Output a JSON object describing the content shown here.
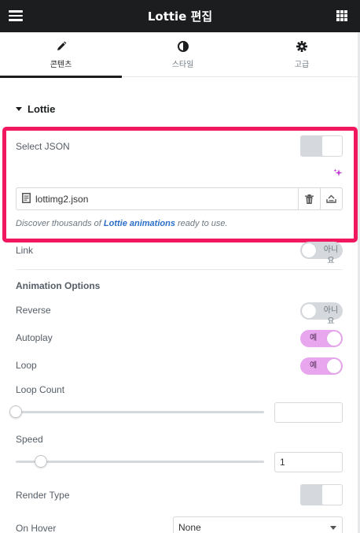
{
  "header": {
    "title": "Lottie 편집",
    "menu_icon": "hamburger-icon",
    "apps_icon": "grid-icon"
  },
  "tabs": [
    {
      "label": "콘텐츠",
      "icon": "pencil-icon",
      "active": true
    },
    {
      "label": "스타일",
      "icon": "half-circle-icon",
      "active": false
    },
    {
      "label": "고급",
      "icon": "gear-icon",
      "active": false
    }
  ],
  "section": {
    "title": "Lottie"
  },
  "select_json": {
    "label": "Select JSON",
    "ai_icon": "sparkle-icon",
    "accent": "#c036d4"
  },
  "file": {
    "name": "lottimg2.json",
    "delete_icon": "trash-icon",
    "upload_icon": "upload-icon"
  },
  "note": {
    "prefix": "Discover thousands of ",
    "link": "Lottie animations",
    "suffix": " ready to use."
  },
  "link_row": {
    "label": "Link",
    "switch_text": "아니요",
    "on": false
  },
  "animation_options": {
    "title": "Animation Options",
    "reverse": {
      "label": "Reverse",
      "switch_text": "아니요",
      "on": false
    },
    "autoplay": {
      "label": "Autoplay",
      "switch_text": "예",
      "on": true
    },
    "loop": {
      "label": "Loop",
      "switch_text": "예",
      "on": true
    },
    "loop_count": {
      "label": "Loop Count",
      "value": "",
      "slider_fraction": 0
    },
    "speed": {
      "label": "Speed",
      "value": "1",
      "slider_fraction": 0.1
    },
    "render_type": {
      "label": "Render Type"
    },
    "on_hover": {
      "label": "On Hover",
      "value": "None"
    }
  },
  "colors": {
    "highlight": "#f1185f",
    "switch_on": "#e8a6ee",
    "link": "#2b6ec9"
  }
}
